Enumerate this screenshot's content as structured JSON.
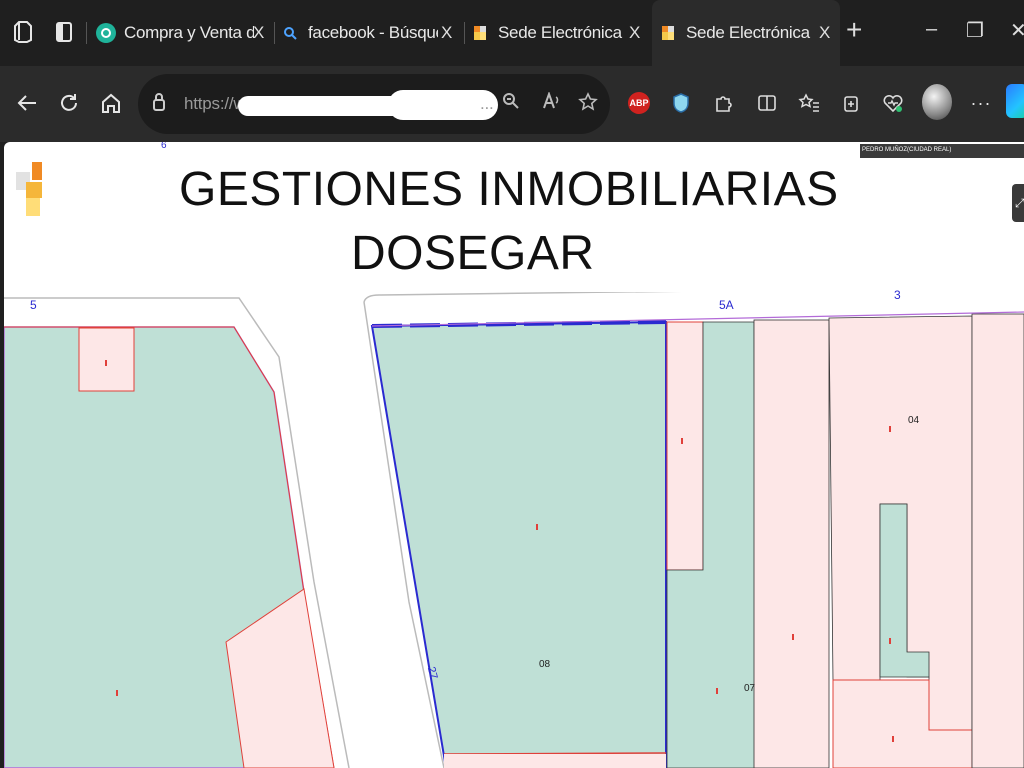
{
  "tabs": [
    {
      "title": "Compra y Venta de Artícu",
      "close": "X"
    },
    {
      "title": "facebook - Búsqueda",
      "close": "X"
    },
    {
      "title": "Sede Electrónica del Cata",
      "close": "X"
    },
    {
      "title": "Sede Electrónica del Cata",
      "close": "X"
    }
  ],
  "new_tab": "+",
  "window_controls": {
    "minimize": "–",
    "restore": "❐",
    "close": "✕"
  },
  "address": {
    "url_visible": "https://w",
    "url_suffix": "..."
  },
  "page": {
    "heading_line1": "GESTIONES INMOBILIARIAS",
    "heading_line2": "DOSEGAR",
    "owner_label": "PEDRO MUÑOZ(CIUDAD REAL)"
  },
  "map_labels": {
    "street_top_left": "6",
    "street_left": "5",
    "street_mid": "5A",
    "street_right": "3",
    "parcel_08": "08",
    "parcel_07": "07",
    "parcel_04": "04",
    "diag_road": "27"
  },
  "colors": {
    "parcel_green": "#bfe0d6",
    "parcel_pink": "#fde7e7",
    "parcel_line_red": "#e0403a",
    "boundary_blue": "#2a2ad0",
    "street_purple": "#b36bd8"
  }
}
